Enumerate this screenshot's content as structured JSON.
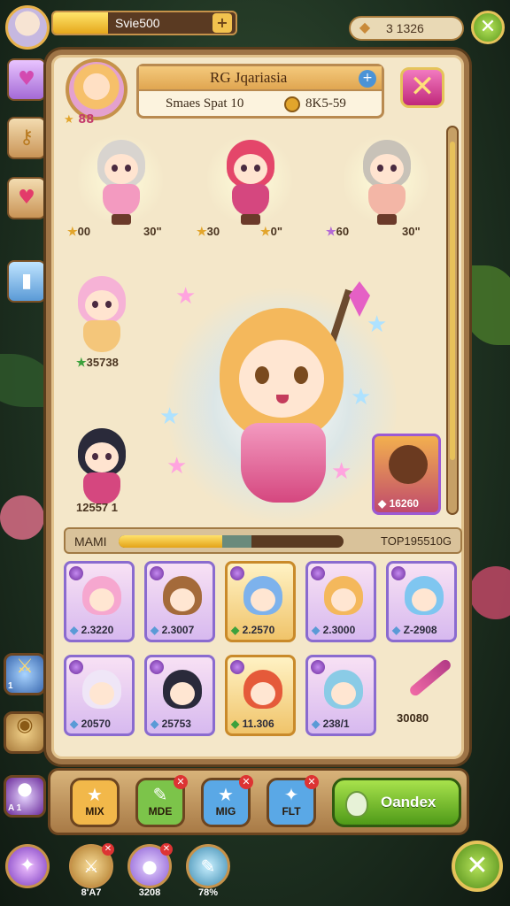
{
  "top_bar": {
    "energy_text": "Svie500",
    "energy_fill": 0.3,
    "energy_plus": "+",
    "gems_text": "3 1326",
    "close_label": "✕"
  },
  "panel": {
    "title": "RG Jqariasia",
    "subtitle": "Smaes Spat 10",
    "currency": "8K5-59",
    "info_label": "+",
    "close_label": "✕",
    "hero_level": "88"
  },
  "featured_row": [
    {
      "stat_left": "00",
      "stat_right": "30\""
    },
    {
      "stat_left": "30",
      "stat_right": "0\""
    },
    {
      "stat_left": "60",
      "stat_right": "30\""
    }
  ],
  "side_heroes": [
    {
      "value": "35738"
    },
    {
      "value": "12557 1"
    }
  ],
  "locked_card": {
    "value": "16260"
  },
  "progress": {
    "label": "MAMI",
    "fill": 0.46,
    "secondary_fill": 0.13,
    "value": "TOP195510G"
  },
  "roster": [
    {
      "value": "2.3220",
      "gold": false,
      "hair": "#f6a7cf"
    },
    {
      "value": "2.3007",
      "gold": false,
      "hair": "#a46a3a"
    },
    {
      "value": "2.2570",
      "gold": true,
      "hair": "#7db2ec"
    },
    {
      "value": "2.3000",
      "gold": false,
      "hair": "#f4b85c"
    },
    {
      "value": "Z-2908",
      "gold": false,
      "hair": "#7fc6f0"
    },
    {
      "value": "20570",
      "gold": false,
      "hair": "#efe6f7"
    },
    {
      "value": "25753",
      "gold": false,
      "hair": "#2a2a3a"
    },
    {
      "value": "11.306",
      "gold": true,
      "hair": "#e55a3a"
    },
    {
      "value": "238/1",
      "gold": false,
      "hair": "#8acbe6"
    }
  ],
  "potion": {
    "value": "30080"
  },
  "toolbar": [
    {
      "icon": "★",
      "label": "MIX",
      "color": "#f2b84a"
    },
    {
      "icon": "✎",
      "label": "MDE",
      "color": "#7cc44a"
    },
    {
      "icon": "★",
      "label": "MIG",
      "color": "#5aa8e6"
    },
    {
      "icon": "✦",
      "label": "FLT",
      "color": "#5aa8e6"
    }
  ],
  "primary_action": {
    "label": "Oandex"
  },
  "dock": [
    {
      "value": "8'A7"
    },
    {
      "value": "3208"
    },
    {
      "value": "78%"
    }
  ],
  "left_items": [
    {
      "value": "1"
    },
    {
      "value": "A 1"
    }
  ],
  "colors": {
    "panel_bg": "#f4e7c9",
    "frame": "#9e7446",
    "accent_pink": "#d5477f",
    "accent_green": "#4f9a18"
  }
}
